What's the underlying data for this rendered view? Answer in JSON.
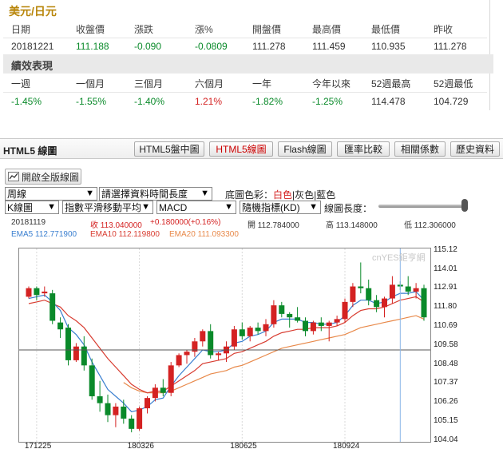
{
  "quote": {
    "title": "美元/日元",
    "headers": [
      "日期",
      "收盤價",
      "漲跌",
      "漲%",
      "開盤價",
      "最高價",
      "最低價",
      "昨收"
    ],
    "values": [
      "20181221",
      "111.188",
      "-0.090",
      "-0.0809",
      "111.278",
      "111.459",
      "110.935",
      "111.278"
    ],
    "perf_title": "績效表現",
    "perf_headers": [
      "一週",
      "一個月",
      "三個月",
      "六個月",
      "一年",
      "今年以來",
      "52週最高",
      "52週最低"
    ],
    "perf_values": [
      "-1.45%",
      "-1.55%",
      "-1.40%",
      "1.21%",
      "-1.82%",
      "-1.25%",
      "114.478",
      "104.729"
    ]
  },
  "chartbar": {
    "title": "HTML5 線圖",
    "tabs": [
      "HTML5盤中圖",
      "HTML5線圖",
      "Flash線圖",
      "匯率比較",
      "相關係數",
      "歷史資料"
    ],
    "active_tab": 1
  },
  "controls": {
    "fullscreen_label": "開啟全版線圖",
    "period": "周線",
    "range_placeholder": "請選擇資料時間長度",
    "bg_label": "底圖色彩：",
    "bg_white": "白色",
    "bg_gray": "灰色",
    "bg_blue": "藍色",
    "sep": "|",
    "chart_type": "K線圖",
    "indicator1": "指數平滑移動平均",
    "indicator2": "MACD",
    "indicator3": "隨機指標(KD)",
    "length_label": "線圖長度："
  },
  "info": {
    "date": "20181119",
    "close": "收 113.040000",
    "change": "+0.180000(+0.16%)",
    "open": "開 112.784000",
    "high": "高 113.148000",
    "low": "低 112.306000",
    "ema5": "EMA5 112.771900",
    "ema10": "EMA10 112.119800",
    "ema20": "EMA20 111.093300"
  },
  "colors": {
    "up": "#d42222",
    "down": "#0a8a2a",
    "ema5": "#3a7fd0",
    "ema10": "#d83c30",
    "ema20": "#e8894a",
    "crosshair_h": "#555555",
    "crosshair_v": "#8ab6e8"
  },
  "chart_data": {
    "type": "candlestick",
    "ylim": [
      104.04,
      115.12
    ],
    "y_ticks": [
      "115.12",
      "114.01",
      "112.91",
      "111.80",
      "110.69",
      "109.58",
      "108.48",
      "107.37",
      "106.26",
      "105.15",
      "104.04"
    ],
    "x_ticks": [
      "171225",
      "180326",
      "180625",
      "180924"
    ],
    "x_tick_index": [
      1,
      14,
      27,
      40
    ],
    "watermark": "cnYES鉅亨網",
    "crosshair": {
      "index": 47,
      "price": 109.3
    },
    "candles": [
      [
        112.4,
        113.0,
        112.3,
        112.9
      ],
      [
        112.9,
        113.0,
        112.2,
        112.5
      ],
      [
        112.6,
        113.0,
        112.4,
        112.7
      ],
      [
        112.6,
        112.8,
        110.8,
        111.0
      ],
      [
        110.9,
        111.2,
        110.0,
        110.5
      ],
      [
        110.6,
        110.8,
        108.4,
        108.7
      ],
      [
        108.7,
        109.7,
        108.6,
        109.5
      ],
      [
        109.5,
        110.1,
        108.1,
        108.4
      ],
      [
        108.4,
        108.8,
        106.4,
        106.6
      ],
      [
        106.6,
        107.5,
        105.7,
        106.2
      ],
      [
        106.2,
        106.7,
        105.1,
        105.5
      ],
      [
        105.5,
        106.2,
        104.8,
        106.0
      ],
      [
        106.0,
        106.4,
        105.0,
        105.3
      ],
      [
        105.3,
        105.5,
        104.5,
        104.7
      ],
      [
        104.7,
        106.0,
        104.6,
        105.9
      ],
      [
        105.9,
        106.6,
        105.6,
        106.5
      ],
      [
        106.5,
        107.3,
        106.3,
        107.1
      ],
      [
        107.1,
        107.6,
        106.6,
        106.8
      ],
      [
        106.8,
        108.6,
        106.6,
        108.4
      ],
      [
        108.4,
        109.1,
        108.3,
        109.0
      ],
      [
        109.0,
        109.3,
        108.5,
        109.2
      ],
      [
        109.2,
        110.0,
        108.9,
        109.8
      ],
      [
        109.8,
        110.5,
        109.5,
        110.4
      ],
      [
        110.4,
        110.8,
        108.8,
        109.0
      ],
      [
        109.0,
        109.2,
        108.7,
        109.1
      ],
      [
        109.1,
        109.8,
        108.6,
        109.5
      ],
      [
        109.5,
        110.7,
        109.3,
        110.5
      ],
      [
        110.5,
        110.9,
        109.9,
        110.1
      ],
      [
        110.1,
        110.7,
        109.8,
        110.6
      ],
      [
        110.6,
        110.9,
        110.2,
        110.4
      ],
      [
        110.4,
        111.1,
        110.1,
        110.8
      ],
      [
        110.8,
        112.2,
        110.6,
        111.9
      ],
      [
        111.9,
        112.1,
        111.2,
        111.4
      ],
      [
        111.4,
        111.5,
        110.6,
        111.2
      ],
      [
        111.2,
        111.8,
        110.9,
        111.0
      ],
      [
        111.0,
        111.2,
        110.1,
        110.4
      ],
      [
        110.4,
        111.0,
        110.2,
        110.9
      ],
      [
        110.9,
        111.2,
        110.4,
        110.7
      ],
      [
        110.7,
        111.0,
        109.8,
        110.9
      ],
      [
        110.9,
        111.3,
        110.7,
        111.1
      ],
      [
        111.1,
        112.3,
        110.9,
        112.1
      ],
      [
        112.1,
        113.2,
        111.8,
        113.0
      ],
      [
        113.0,
        114.4,
        112.6,
        112.9
      ],
      [
        112.9,
        113.4,
        111.9,
        112.2
      ],
      [
        112.2,
        112.5,
        111.5,
        111.8
      ],
      [
        111.8,
        112.4,
        111.2,
        112.3
      ],
      [
        112.3,
        113.6,
        112.0,
        113.1
      ],
      [
        113.1,
        113.3,
        112.8,
        113.0
      ],
      [
        113.0,
        113.6,
        112.5,
        112.7
      ],
      [
        112.7,
        113.2,
        112.3,
        112.9
      ],
      [
        112.9,
        113.1,
        111.0,
        111.2
      ]
    ],
    "ema5": [
      112.3,
      112.4,
      112.5,
      112.1,
      111.6,
      110.6,
      110.2,
      109.6,
      108.6,
      107.8,
      107.0,
      106.6,
      106.2,
      105.7,
      105.8,
      106.0,
      106.4,
      106.5,
      107.2,
      107.8,
      108.3,
      108.8,
      109.3,
      109.2,
      109.2,
      109.3,
      109.7,
      109.8,
      110.1,
      110.2,
      110.4,
      110.9,
      111.1,
      111.1,
      111.1,
      110.9,
      110.9,
      110.8,
      110.8,
      110.9,
      111.3,
      111.9,
      112.2,
      112.2,
      112.0,
      112.1,
      112.4,
      112.6,
      112.6,
      112.7,
      112.2
    ],
    "ema10": [
      112.0,
      112.1,
      112.2,
      112.0,
      111.8,
      111.3,
      111.0,
      110.6,
      110.0,
      109.4,
      108.8,
      108.3,
      107.8,
      107.3,
      107.0,
      106.8,
      106.9,
      106.9,
      107.2,
      107.5,
      107.8,
      108.1,
      108.5,
      108.6,
      108.7,
      108.8,
      109.1,
      109.2,
      109.4,
      109.6,
      109.8,
      110.1,
      110.3,
      110.4,
      110.5,
      110.5,
      110.6,
      110.6,
      110.6,
      110.7,
      110.9,
      111.3,
      111.6,
      111.7,
      111.7,
      111.8,
      112.0,
      112.2,
      112.3,
      112.4,
      112.1
    ],
    "ema20": [
      null,
      null,
      null,
      null,
      null,
      null,
      null,
      null,
      null,
      null,
      null,
      null,
      107.4,
      107.1,
      106.9,
      106.8,
      106.8,
      106.8,
      106.9,
      107.1,
      107.3,
      107.5,
      107.7,
      107.9,
      108.0,
      108.1,
      108.3,
      108.4,
      108.6,
      108.8,
      109.0,
      109.2,
      109.4,
      109.5,
      109.6,
      109.7,
      109.8,
      109.9,
      110.0,
      110.1,
      110.2,
      110.4,
      110.6,
      110.7,
      110.8,
      110.9,
      111.0,
      111.1,
      111.2,
      111.3,
      111.1
    ]
  }
}
